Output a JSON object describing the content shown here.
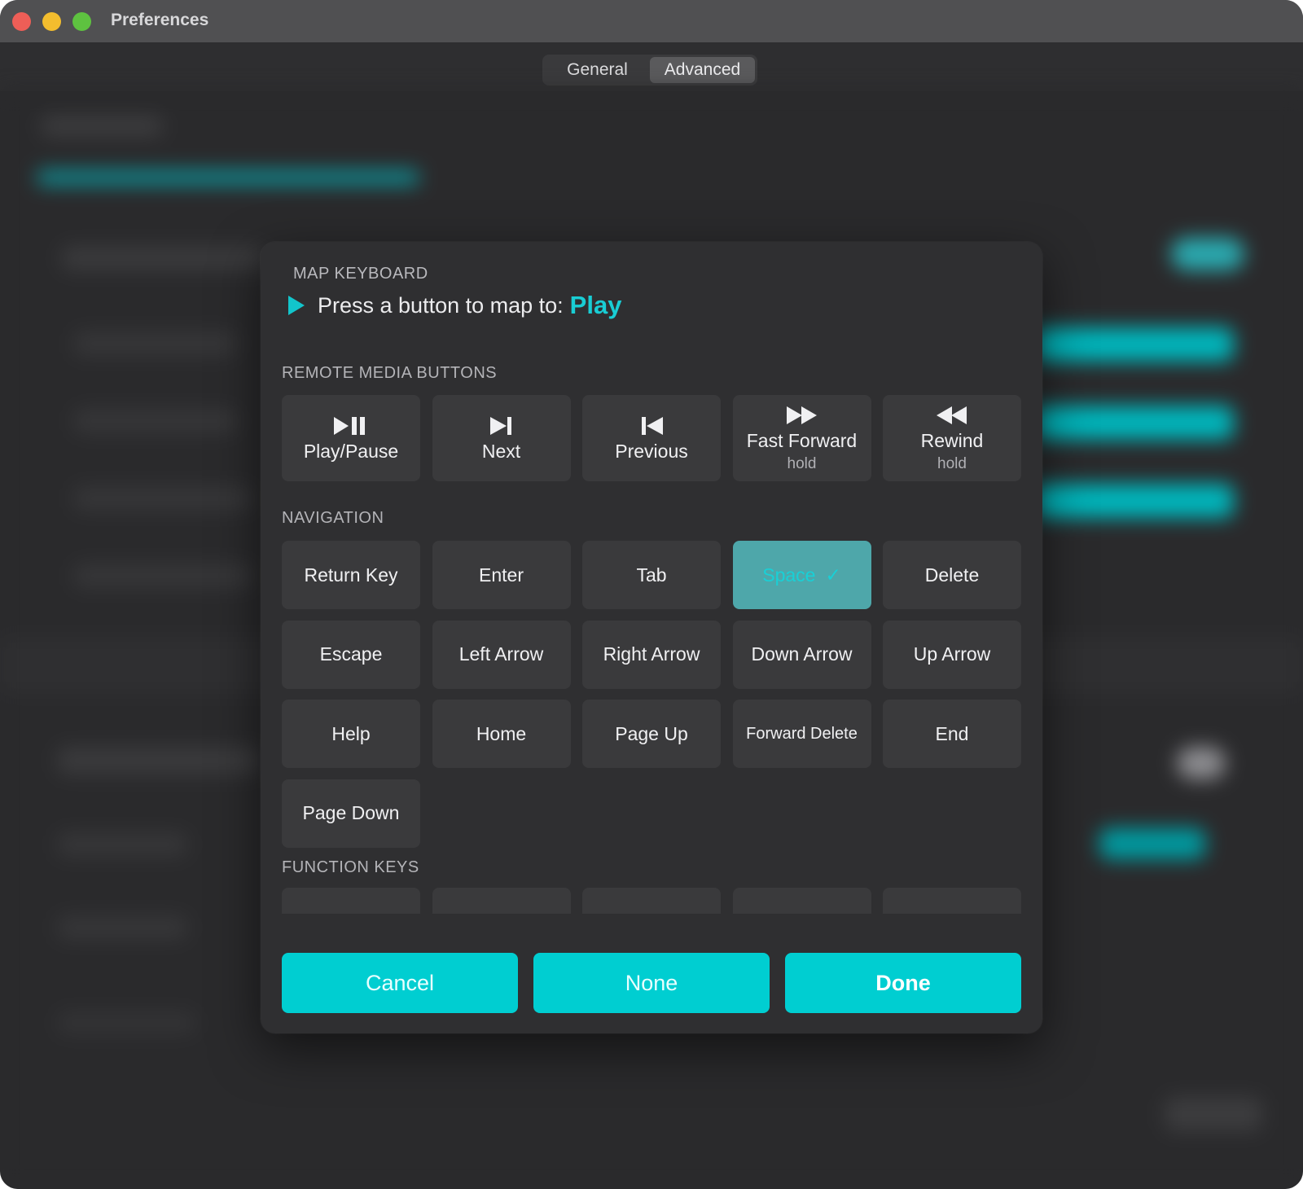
{
  "window": {
    "title": "Preferences",
    "controls": [
      "close",
      "minimize",
      "zoom"
    ]
  },
  "tabs": [
    {
      "label": "General",
      "selected": false
    },
    {
      "label": "Advanced",
      "selected": true
    }
  ],
  "dialog": {
    "kicker": "MAP KEYBOARD",
    "prompt": "Press a button to map to:",
    "target": "Play",
    "sections": {
      "remote": {
        "label": "REMOTE MEDIA BUTTONS",
        "keys": [
          {
            "label": "Play/Pause",
            "icon": "play-pause-icon",
            "sub": ""
          },
          {
            "label": "Next",
            "icon": "next-track-icon",
            "sub": ""
          },
          {
            "label": "Previous",
            "icon": "previous-track-icon",
            "sub": ""
          },
          {
            "label": "Fast Forward",
            "icon": "fast-forward-icon",
            "sub": "hold"
          },
          {
            "label": "Rewind",
            "icon": "rewind-icon",
            "sub": "hold"
          }
        ]
      },
      "navigation": {
        "label": "NAVIGATION",
        "keys": [
          {
            "label": "Return Key"
          },
          {
            "label": "Enter"
          },
          {
            "label": "Tab"
          },
          {
            "label": "Space",
            "selected": true,
            "mark": "✓"
          },
          {
            "label": "Delete"
          },
          {
            "label": "Escape"
          },
          {
            "label": "Left Arrow"
          },
          {
            "label": "Right Arrow"
          },
          {
            "label": "Down Arrow"
          },
          {
            "label": "Up Arrow"
          },
          {
            "label": "Help"
          },
          {
            "label": "Home"
          },
          {
            "label": "Page Up"
          },
          {
            "label": "Forward Delete"
          },
          {
            "label": "End"
          },
          {
            "label": "Page Down"
          }
        ]
      },
      "function": {
        "label": "FUNCTION KEYS"
      }
    },
    "actions": {
      "cancel": "Cancel",
      "none": "None",
      "done": "Done"
    }
  },
  "colors": {
    "accent": "#00ced1",
    "selected_key": "#4ea7aa",
    "window_bg": "#2b2b2d",
    "dialog_bg": "#2f2f31",
    "key_bg": "#3a3a3c"
  }
}
